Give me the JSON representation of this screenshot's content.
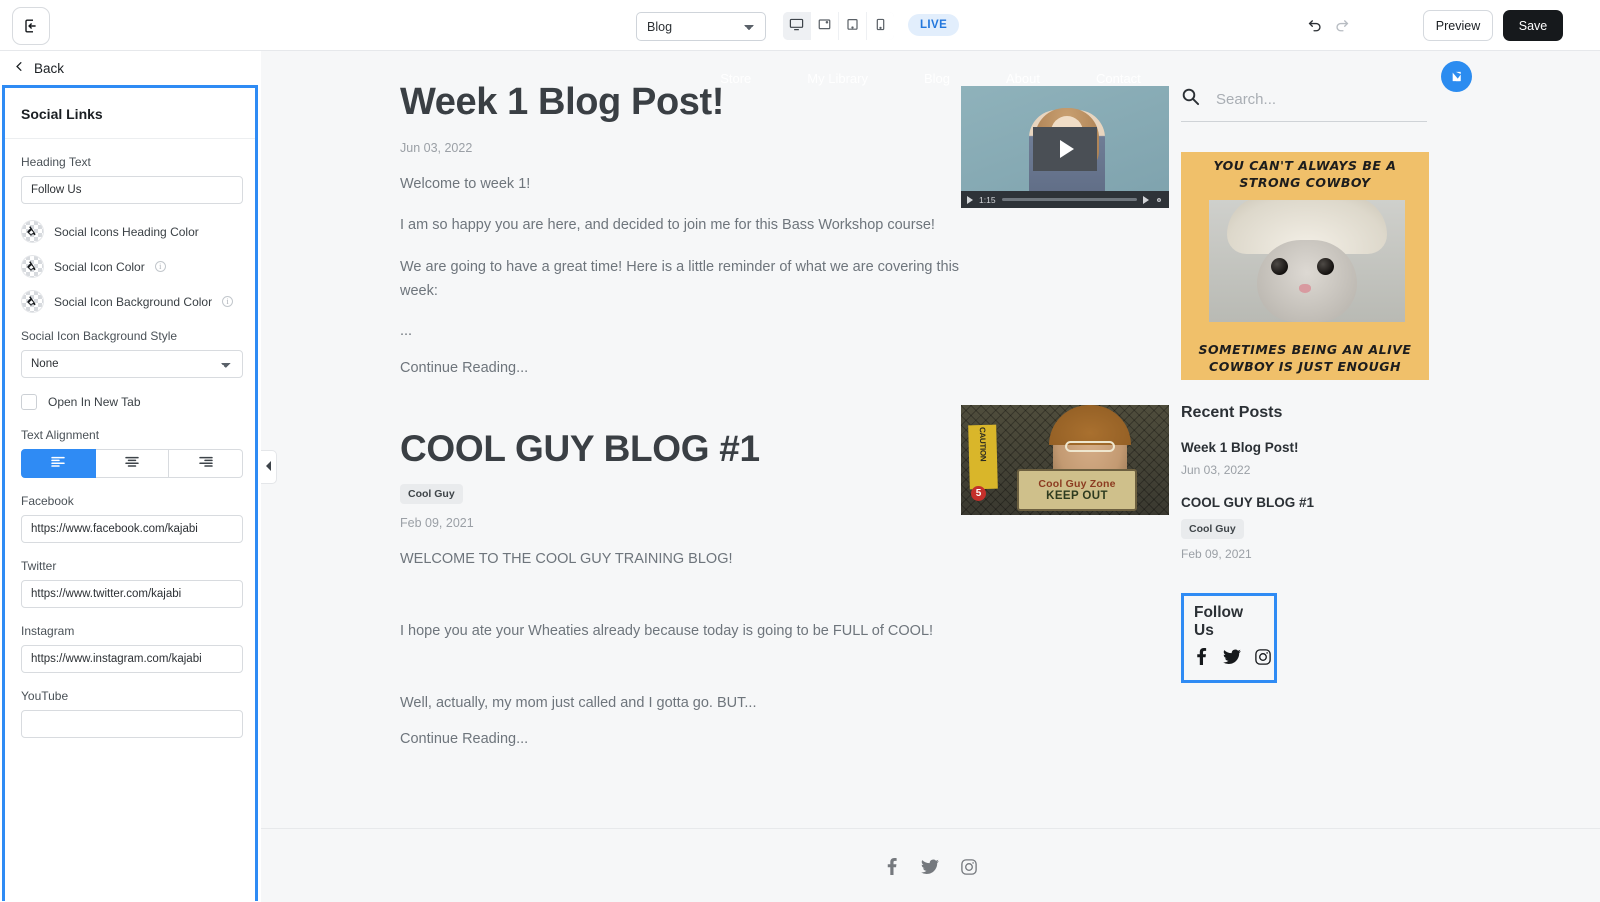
{
  "toolbar": {
    "exit_icon": "exit-icon",
    "page_select_value": "Blog",
    "page_select_options": [
      "Blog"
    ],
    "devices": [
      {
        "name": "desktop",
        "icon": "desktop-icon",
        "active": true
      },
      {
        "name": "laptop",
        "icon": "laptop-icon",
        "active": false
      },
      {
        "name": "tablet",
        "icon": "tablet-icon",
        "active": false
      },
      {
        "name": "mobile",
        "icon": "mobile-icon",
        "active": false
      }
    ],
    "live_badge": "LIVE",
    "undo_icon": "undo-icon",
    "redo_icon": "redo-icon",
    "preview_label": "Preview",
    "save_label": "Save",
    "accent_color": "#2f8bf4",
    "save_bg": "#16191c"
  },
  "left_panel": {
    "back_label": "Back",
    "title": "Social Links",
    "heading_text_label": "Heading Text",
    "heading_text_value": "Follow Us",
    "colors": [
      {
        "label": "Social Icons Heading Color",
        "has_info": false,
        "value": "none"
      },
      {
        "label": "Social Icon Color",
        "has_info": true,
        "value": "none"
      },
      {
        "label": "Social Icon Background Color",
        "has_info": true,
        "value": "none"
      }
    ],
    "bg_style_label": "Social Icon Background Style",
    "bg_style_value": "None",
    "bg_style_options": [
      "None"
    ],
    "open_new_tab_label": "Open In New Tab",
    "open_new_tab_checked": false,
    "text_alignment_label": "Text Alignment",
    "alignment_selected": "left",
    "alignment_options": [
      "left",
      "center",
      "right"
    ],
    "links": [
      {
        "label": "Facebook",
        "value": "https://www.facebook.com/kajabi"
      },
      {
        "label": "Twitter",
        "value": "https://www.twitter.com/kajabi"
      },
      {
        "label": "Instagram",
        "value": "https://www.instagram.com/kajabi"
      },
      {
        "label": "YouTube",
        "value": ""
      }
    ]
  },
  "canvas": {
    "nav_items": [
      "Store",
      "My Library",
      "Blog",
      "About",
      "Contact"
    ],
    "brand_badge_icon": "kajabi-logo-icon",
    "posts": [
      {
        "title": "Week 1 Blog Post!",
        "date": "Jun 03, 2022",
        "tag": null,
        "paragraphs": [
          "Welcome to week 1!",
          "I am so happy you are here, and decided to join me for this Bass Workshop course!",
          "We are going to have a great time! Here is a little reminder of what we are covering this week:",
          "..."
        ],
        "continue_label": "Continue Reading..."
      },
      {
        "title": "COOL GUY BLOG #1",
        "date": "Feb 09, 2021",
        "tag": "Cool Guy",
        "paragraphs": [
          "WELCOME TO THE COOL GUY TRAINING BLOG!",
          "I hope you ate your Wheaties already because today is going to be FULL of COOL!",
          "Well, actually, my mom just called and I gotta go. BUT..."
        ],
        "continue_label": "Continue Reading..."
      }
    ],
    "video": {
      "duration": "1:15",
      "play_icon": "play-icon",
      "volume_icon": "volume-icon",
      "settings_icon": "settings-gear-icon"
    },
    "cool_guy_image": {
      "caution_text": "CAUTION",
      "sign_line1": "Cool Guy Zone",
      "sign_line2": "KEEP OUT",
      "channel_badge": "5"
    },
    "sidebar": {
      "search_placeholder": "Search...",
      "search_icon": "search-icon",
      "meme": {
        "top_text": "YOU CAN'T ALWAYS BE A STRONG COWBOY",
        "bottom_text": "SOMETIMES BEING AN ALIVE COWBOY IS JUST ENOUGH",
        "bg_color": "#f0c06a"
      },
      "recent_posts_title": "Recent Posts",
      "recent_posts": [
        {
          "title": "Week 1 Blog Post!",
          "date": "Jun 03, 2022",
          "tag": null
        },
        {
          "title": "COOL GUY BLOG #1",
          "date": "Feb 09, 2021",
          "tag": "Cool Guy"
        }
      ],
      "follow": {
        "title": "Follow Us",
        "icons": [
          "facebook-icon",
          "twitter-icon",
          "instagram-icon"
        ],
        "selected_outline_color": "#2f8bf4"
      }
    },
    "footer_icons": [
      "facebook-icon",
      "twitter-icon",
      "instagram-icon"
    ]
  }
}
